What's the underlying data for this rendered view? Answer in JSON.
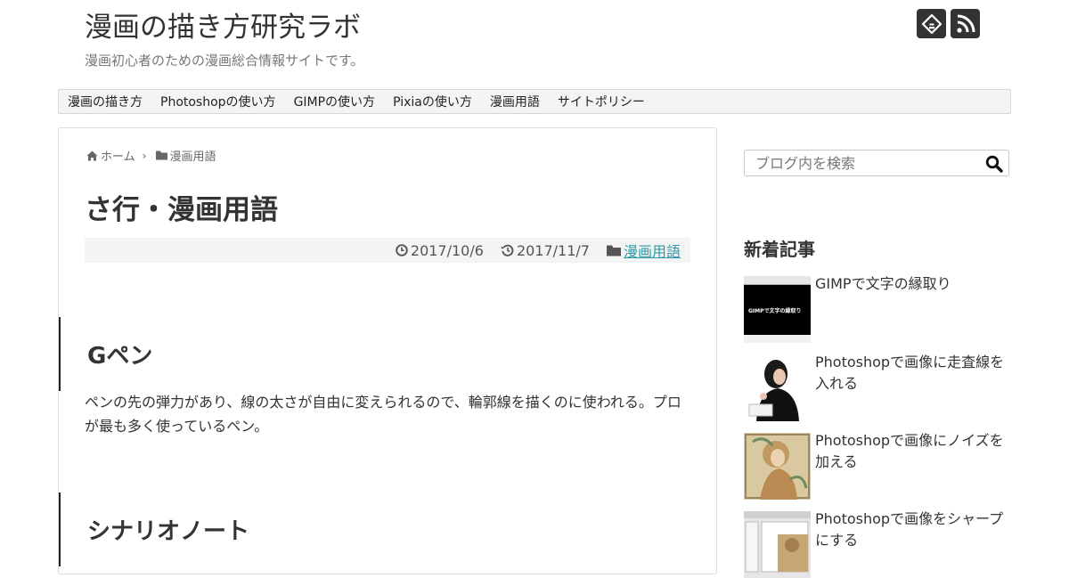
{
  "site": {
    "title": "漫画の描き方研究ラボ",
    "description": "漫画初心者のための漫画総合情報サイトです。"
  },
  "header_icons": [
    "feedly-icon",
    "rss-icon"
  ],
  "nav": {
    "items": [
      "漫画の描き方",
      "Photoshopの使い方",
      "GIMPの使い方",
      "Pixiaの使い方",
      "漫画用語",
      "サイトポリシー"
    ]
  },
  "breadcrumb": {
    "home": "ホーム",
    "category": "漫画用語"
  },
  "article": {
    "title": "さ行・漫画用語",
    "posted_date": "2017/10/6",
    "updated_date": "2017/11/7",
    "category": "漫画用語",
    "sections": [
      {
        "heading": "Gペン",
        "body": "ペンの先の弾力があり、線の太さが自由に変えられるので、輪郭線を描くのに使われる。プロが最も多く使っているペン。"
      },
      {
        "heading": "シナリオノート"
      }
    ]
  },
  "sidebar": {
    "search_placeholder": "ブログ内を検索",
    "recent_title": "新着記事",
    "recent_posts": [
      {
        "title": "GIMPで文字の縁取り",
        "thumb_text": "GIMPで文字の縁取り"
      },
      {
        "title": "Photoshopで画像に走査線を入れる"
      },
      {
        "title": "Photoshopで画像にノイズを加える"
      },
      {
        "title": "Photoshopで画像をシャープにする"
      }
    ]
  },
  "colors": {
    "accent_link": "#2a9aa8",
    "nav_bg": "#f4f4f4",
    "icon_bg": "#333333"
  }
}
